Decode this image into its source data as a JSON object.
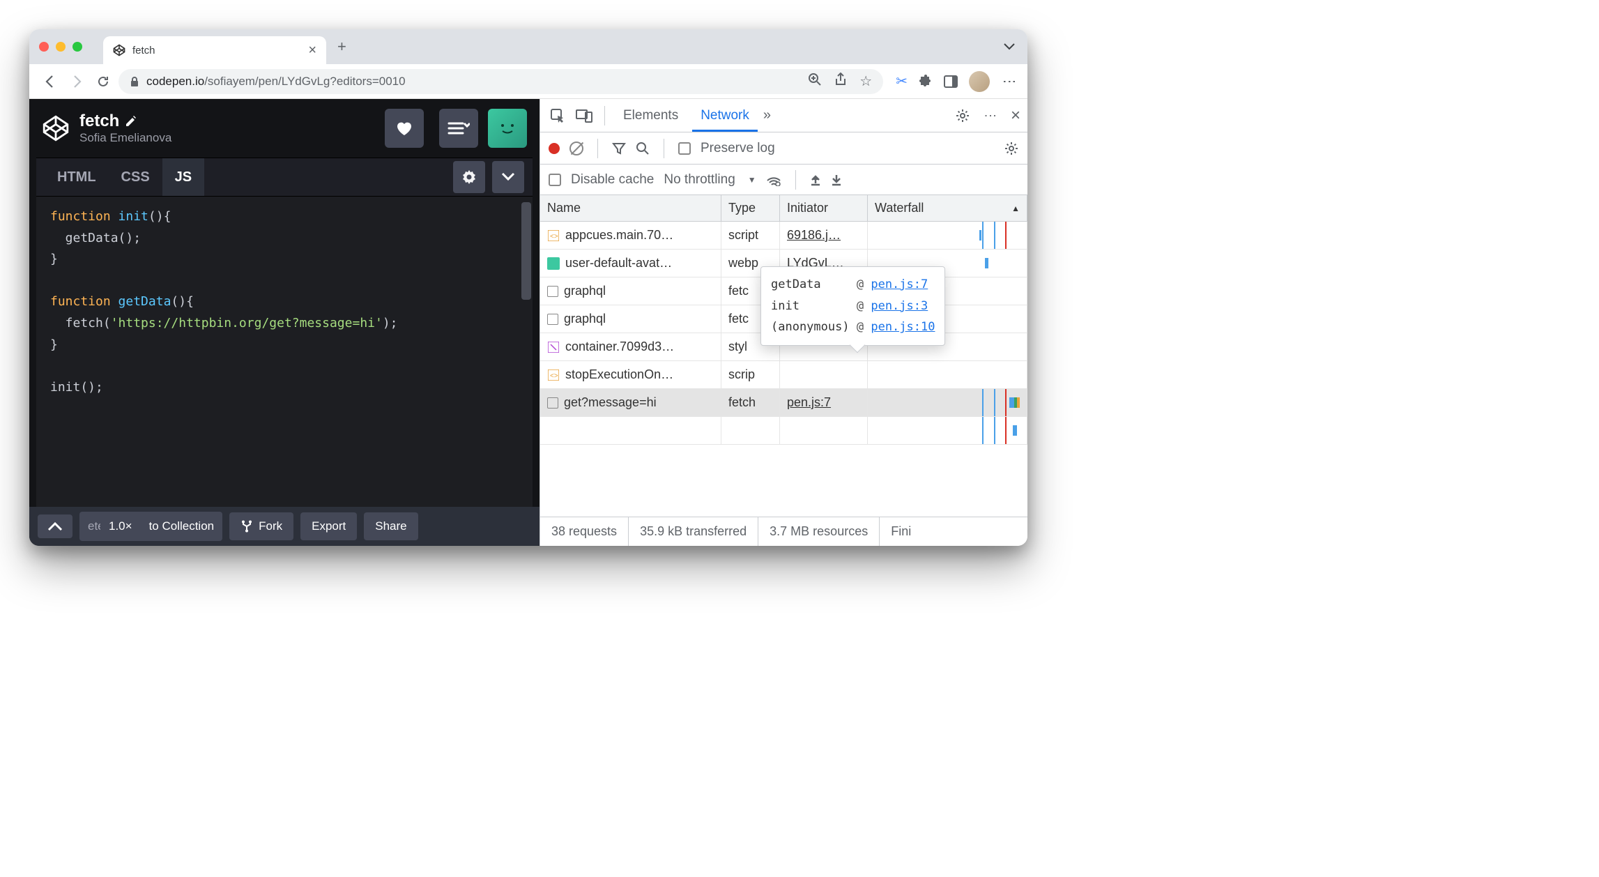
{
  "browser": {
    "tab_title": "fetch",
    "url_domain": "codepen.io",
    "url_path": "/sofiayem/pen/LYdGvLg?editors=0010"
  },
  "codepen": {
    "title": "fetch",
    "author": "Sofia Emelianova",
    "tabs": {
      "html": "HTML",
      "css": "CSS",
      "js": "JS"
    },
    "footer": {
      "zoom_partial": "ete",
      "zoom": "1.0×",
      "collection": "to Collection",
      "fork": "Fork",
      "export": "Export",
      "share": "Share"
    }
  },
  "devtools": {
    "tabs": {
      "elements": "Elements",
      "network": "Network"
    },
    "preserve_log": "Preserve log",
    "disable_cache": "Disable cache",
    "throttling": "No throttling",
    "columns": {
      "name": "Name",
      "type": "Type",
      "initiator": "Initiator",
      "waterfall": "Waterfall"
    },
    "rows": [
      {
        "name": "appcues.main.70…",
        "type": "script",
        "initiator": "69186.j…"
      },
      {
        "name": "user-default-avat…",
        "type": "webp",
        "initiator": "LYdGvL…"
      },
      {
        "name": "graphql",
        "type": "fetc"
      },
      {
        "name": "graphql",
        "type": "fetc"
      },
      {
        "name": "container.7099d3…",
        "type": "styl"
      },
      {
        "name": "stopExecutionOn…",
        "type": "scrip"
      },
      {
        "name": "get?message=hi",
        "type": "fetch",
        "initiator": "pen.js:7"
      }
    ],
    "tooltip": [
      {
        "fn": "getData",
        "loc": "pen.js:7"
      },
      {
        "fn": "init",
        "loc": "pen.js:3"
      },
      {
        "fn": "(anonymous)",
        "loc": "pen.js:10"
      }
    ],
    "status": {
      "requests": "38 requests",
      "transferred": "35.9 kB transferred",
      "resources": "3.7 MB resources",
      "finish": "Fini"
    }
  },
  "code": {
    "l1_kw": "function",
    "l1_fn": "init",
    "l1_p": "(){",
    "l2": "getData();",
    "l3": "}",
    "l4_kw": "function",
    "l4_fn": "getData",
    "l4_p": "(){",
    "l5a": "fetch(",
    "l5s": "'https://httpbin.org/get?message=hi'",
    "l5b": ");",
    "l6": "}",
    "l7": "init();"
  }
}
